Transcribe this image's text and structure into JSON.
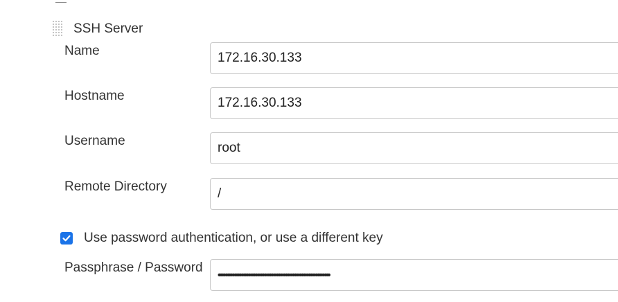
{
  "section": {
    "title": "SSH Server",
    "icon": "drag-handle-icon"
  },
  "fields": {
    "name": {
      "label": "Name",
      "value": "172.16.30.133"
    },
    "hostname": {
      "label": "Hostname",
      "value": "172.16.30.133"
    },
    "username": {
      "label": "Username",
      "value": "root"
    },
    "remote_directory": {
      "label": "Remote Directory",
      "value": "/"
    },
    "passphrase": {
      "label": "Passphrase / Password",
      "masked_value": "•••••••••••••••••••••••••••••••••••••••••••••••••••••••••••••••"
    }
  },
  "use_password_auth": {
    "label": "Use password authentication, or use a different key",
    "checked": true
  },
  "colors": {
    "accent": "#1a73e8",
    "border": "#c8c8c8",
    "text": "#333333"
  }
}
